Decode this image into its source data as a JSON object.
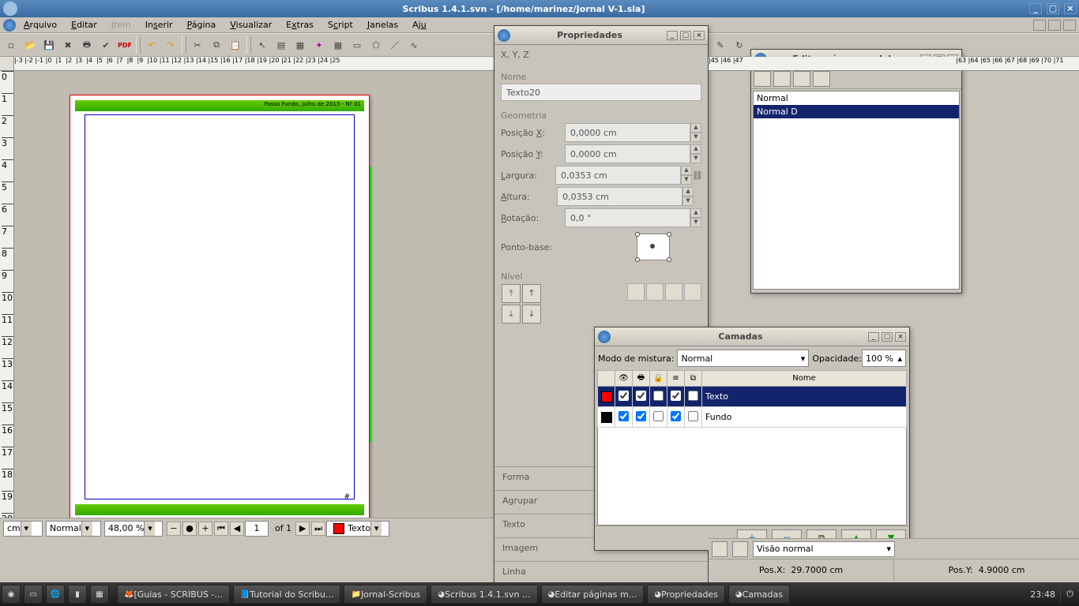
{
  "title": "Scribus 1.4.1.svn - [/home/marinez/Jornal V-1.sla]",
  "menu": {
    "arquivo": "Arquivo",
    "editar": "Editar",
    "item": "Item",
    "inserir": "Inserir",
    "pagina": "Página",
    "visualizar": "Visualizar",
    "extras": "Extras",
    "script": "Script",
    "janelas": "Janelas",
    "ajuda": "Aju"
  },
  "page_caption": "Passo Fundo, julho de 2013 - Nº 01",
  "status": {
    "unit": "cm",
    "layerpreset": "Normal",
    "zoom": "48,00 %",
    "page": "1",
    "pages": "of 1",
    "layer": "Texto",
    "view": "Visão normal",
    "posx_label": "Pos.X:",
    "posx": "29.7000 cm",
    "posy_label": "Pos.Y:",
    "posy": "4.9000 cm"
  },
  "props": {
    "title": "Propriedades",
    "xyz": "X, Y, Z",
    "nome_label": "Nome",
    "nome": "Texto20",
    "geom": "Geometria",
    "posx_l": "Posição X:",
    "posx": "0,0000 cm",
    "posy_l": "Posição Y:",
    "posy": "0,0000 cm",
    "larg_l": "Largura:",
    "larg": "0,0353 cm",
    "alt_l": "Altura:",
    "alt": "0,0353 cm",
    "rot_l": "Rotação:",
    "rot": "0,0 °",
    "base_l": "Ponto-base:",
    "nivel": "Nível",
    "acc": {
      "forma": "Forma",
      "agrupar": "Agrupar",
      "texto": "Texto",
      "imagem": "Imagem",
      "linha": "Linha"
    }
  },
  "masters": {
    "title": "Editar pá...as modelo",
    "items": [
      "Normal",
      "Normal D"
    ],
    "selected": 1
  },
  "layers": {
    "title": "Camadas",
    "blend_l": "Modo de mistura:",
    "blend": "Normal",
    "opac_l": "Opacidade:",
    "opac": "100 %",
    "header_name": "Nome",
    "rows": [
      {
        "color": "#f00",
        "vis": true,
        "print": true,
        "lock": false,
        "flow": true,
        "outline": false,
        "name": "Texto",
        "sel": true
      },
      {
        "color": "#000",
        "vis": true,
        "print": true,
        "lock": false,
        "flow": true,
        "outline": false,
        "name": "Fundo",
        "sel": false
      }
    ]
  },
  "taskbar": {
    "items": [
      "[Guias - SCRIBUS -...",
      "Tutorial do Scribu...",
      "Jornal-Scribus",
      "Scribus 1.4.1.svn ...",
      "Editar páginas m...",
      "Propriedades",
      "Camadas"
    ],
    "clock": "23:48"
  }
}
